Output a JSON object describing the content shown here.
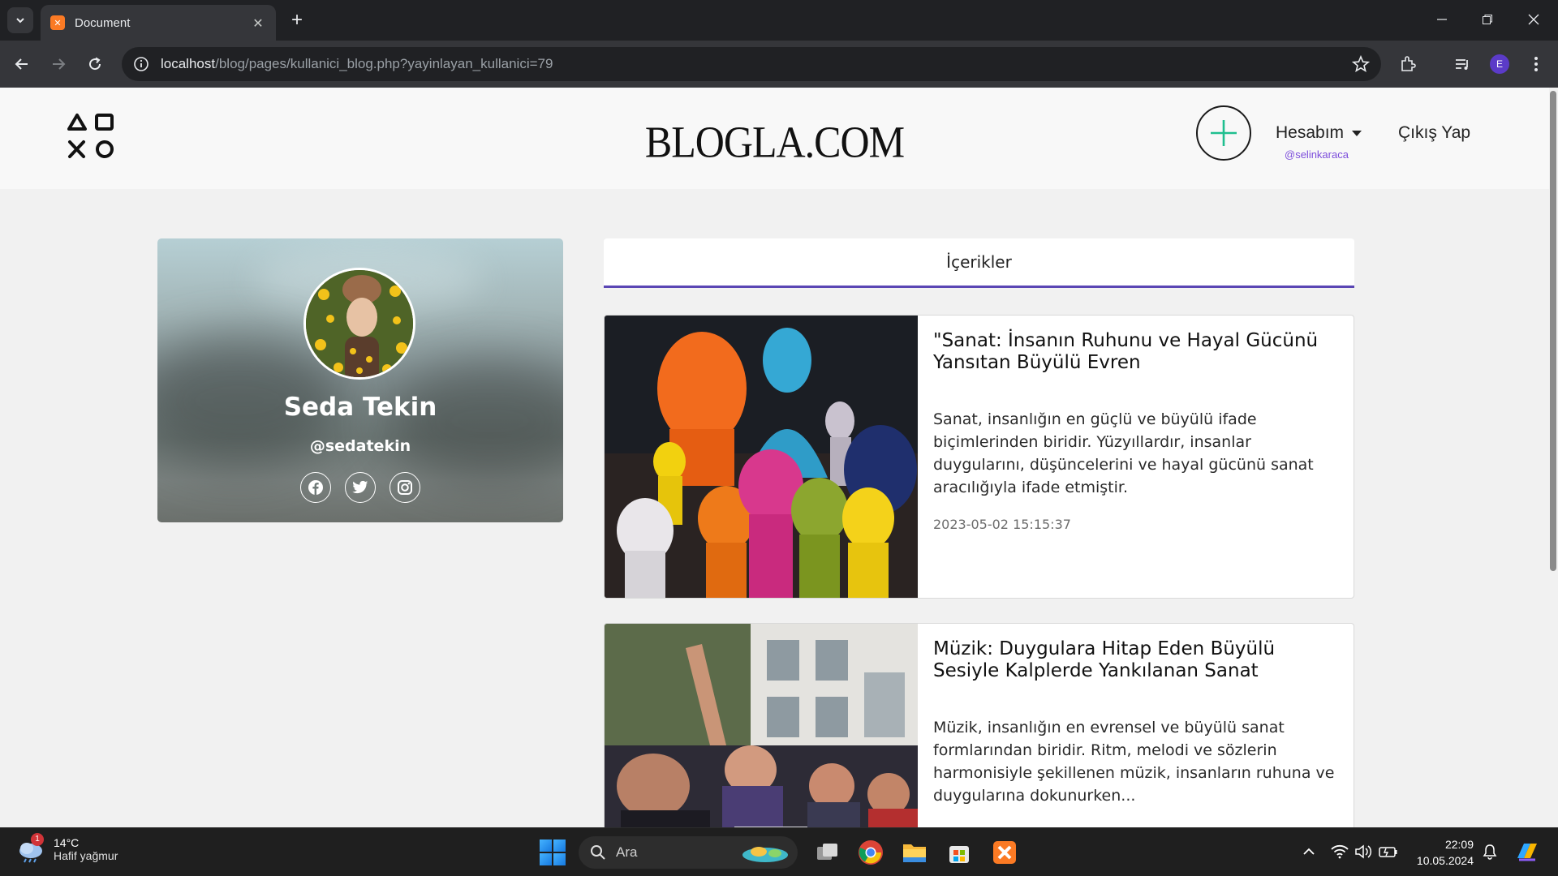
{
  "browser": {
    "tab_title": "Document",
    "url_host": "localhost",
    "url_path": "/blog/pages/kullanici_blog.php?yayinlayan_kullanici=79",
    "profile_initial": "E"
  },
  "header": {
    "brand": "BLOGLA.COM",
    "account_label": "Hesabım",
    "account_username": "@selinkaraca",
    "logout_label": "Çıkış Yap"
  },
  "profile": {
    "name": "Seda Tekin",
    "handle": "@sedatekin",
    "socials": [
      "facebook-icon",
      "twitter-icon",
      "instagram-icon"
    ]
  },
  "content_tab": {
    "label": "İçerikler"
  },
  "posts": [
    {
      "title": "\"Sanat: İnsanın Ruhunu ve Hayal Gücünü Yansıtan Büyülü Evren",
      "text": "Sanat, insanlığın en güçlü ve büyülü ifade biçimlerinden biridir. Yüzyıllardır, insanlar duygularını, düşüncelerini ve hayal gücünü sanat aracılığıyla ifade etmiştir.",
      "date": "2023-05-02 15:15:37"
    },
    {
      "title": "Müzik: Duygulara Hitap Eden Büyülü Sesiyle Kalplerde Yankılanan Sanat",
      "text": "Müzik, insanlığın en evrensel ve büyülü sanat formlarından biridir. Ritm, melodi ve sözlerin harmonisiyle şekillenen müzik, insanların ruhuna ve duygularına dokunurken...",
      "date": ""
    }
  ],
  "taskbar": {
    "weather_badge": "1",
    "weather_temp": "14°C",
    "weather_desc": "Hafif yağmur",
    "search_label": "Ara",
    "time": "22:09",
    "date": "10.05.2024"
  },
  "colors": {
    "accent": "#5a46b4",
    "username": "#7c4ddb",
    "add_button_plus": "#1fbf8f"
  }
}
